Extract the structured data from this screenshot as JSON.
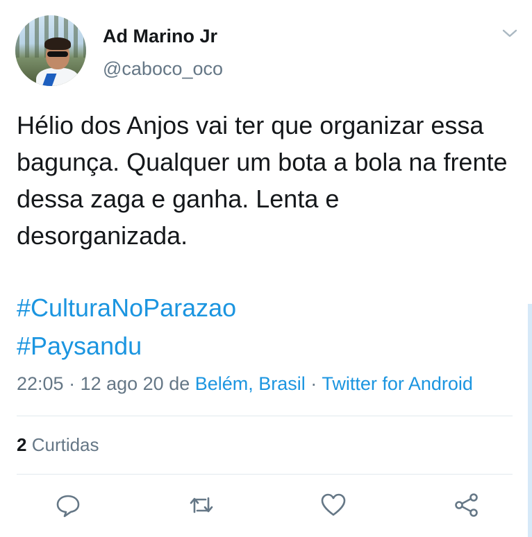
{
  "user": {
    "display_name": "Ad Marino Jr",
    "handle": "@caboco_oco"
  },
  "tweet": {
    "text": "Hélio dos Anjos vai ter que organizar essa bagunça. Qualquer um bota a bola na frente dessa zaga e ganha. Lenta e desorganizada.",
    "hashtags": [
      "#CulturaNoParazao",
      "#Paysandu"
    ]
  },
  "meta": {
    "time": "22:05",
    "sep1": " · ",
    "date": "12 ago 20",
    "from_word": " de ",
    "location": "Belém, Brasil",
    "sep2": " · ",
    "client": "Twitter for Android"
  },
  "stats": {
    "likes_count": "2",
    "likes_label": "Curtidas"
  },
  "icons": {
    "menu": "chevron-down-icon",
    "reply": "reply-icon",
    "retweet": "retweet-icon",
    "like": "heart-icon",
    "share": "share-icon"
  },
  "colors": {
    "link": "#1b95e0",
    "secondary": "#657786",
    "divider": "#e1e8ed"
  }
}
